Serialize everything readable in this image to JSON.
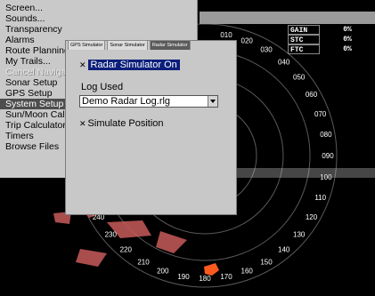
{
  "main_menu": {
    "items": [
      {
        "label": "Screen...",
        "state": "normal"
      },
      {
        "label": "Sounds...",
        "state": "normal"
      },
      {
        "label": "Transparency",
        "state": "normal"
      },
      {
        "label": "Alarms",
        "state": "normal"
      },
      {
        "label": "Route Planning",
        "state": "normal"
      },
      {
        "label": "My Trails...",
        "state": "normal"
      },
      {
        "label": "Cancel Navigation",
        "state": "disabled"
      },
      {
        "label": "Sonar Setup",
        "state": "normal"
      },
      {
        "label": "GPS Setup",
        "state": "normal"
      },
      {
        "label": "System Setup",
        "state": "selected"
      },
      {
        "label": "Sun/Moon Calculations",
        "state": "normal"
      },
      {
        "label": "Trip Calculator",
        "state": "normal"
      },
      {
        "label": "Timers",
        "state": "normal"
      },
      {
        "label": "Browse Files",
        "state": "normal"
      }
    ]
  },
  "radar_readouts": [
    {
      "label": "GAIN",
      "value": "0%"
    },
    {
      "label": "STC",
      "value": "0%"
    },
    {
      "label": "FTC",
      "value": "0%"
    }
  ],
  "bearing_labels": {
    "top": [
      "010",
      "020",
      "030",
      "040"
    ],
    "bottom": [
      "200",
      "190",
      "180",
      "170",
      "160",
      "150"
    ],
    "left": [
      "210",
      "220",
      "230",
      "240"
    ],
    "right": [
      "050",
      "060",
      "070",
      "080",
      "090",
      "100",
      "110",
      "120",
      "130",
      "140"
    ]
  },
  "dialog": {
    "tabs": [
      {
        "label": "GPS Simulator",
        "active": false
      },
      {
        "label": "Sonar Simulator",
        "active": false
      },
      {
        "label": "Radar Simulator",
        "active": true
      }
    ],
    "radar_on": {
      "label": "Radar Simulator On",
      "checked": true
    },
    "log_used_label": "Log Used",
    "log_value": "Demo Radar Log.rlg",
    "simulate_position": {
      "label": "Simulate Position",
      "checked": true
    }
  },
  "colors": {
    "menu_bg": "#c9c9c9",
    "selected_bg": "#4d4d4d",
    "highlight": "#0b1f7a",
    "echo": "#c85a5a",
    "vessel": "#ff5a1e"
  }
}
